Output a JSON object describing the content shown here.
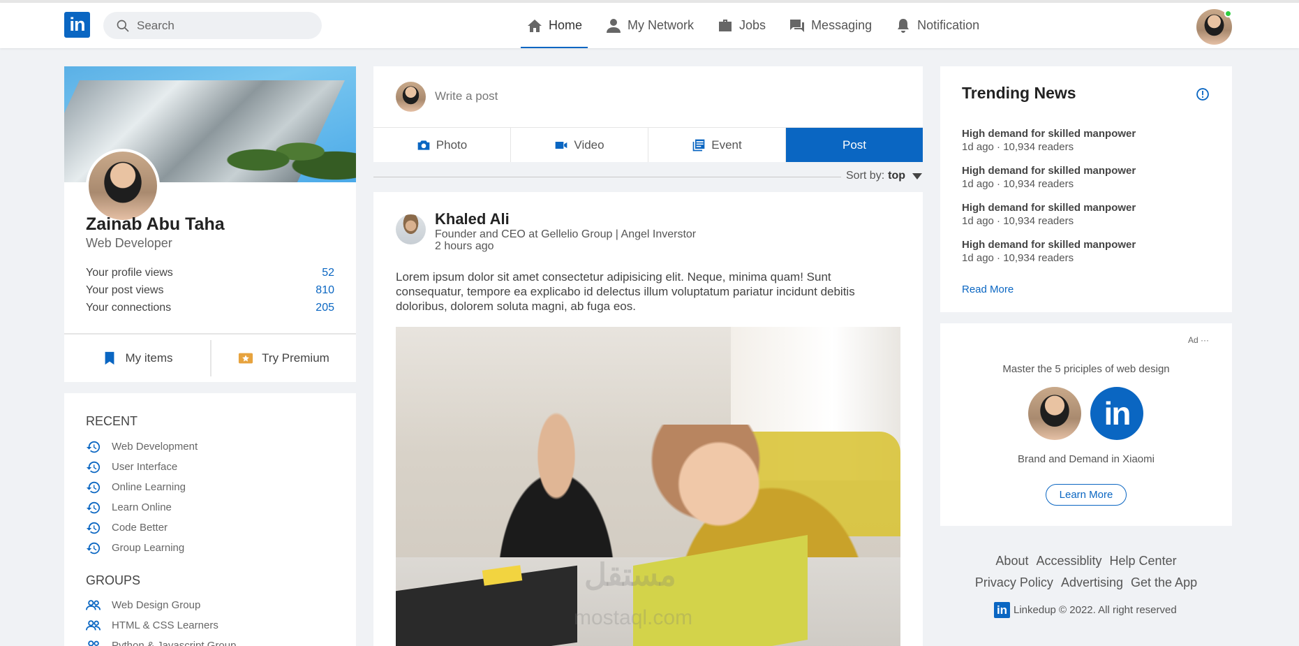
{
  "nav": {
    "logo_text": "in",
    "search_placeholder": "Search",
    "items": [
      {
        "label": "Home",
        "icon": "home-icon"
      },
      {
        "label": "My Network",
        "icon": "person-icon"
      },
      {
        "label": "Jobs",
        "icon": "briefcase-icon"
      },
      {
        "label": "Messaging",
        "icon": "chat-icon"
      },
      {
        "label": "Notification",
        "icon": "bell-icon"
      }
    ]
  },
  "profile": {
    "name": "Zainab Abu Taha",
    "title": "Web Developer",
    "stats": [
      {
        "label": "Your profile views",
        "value": "52"
      },
      {
        "label": "Your post views",
        "value": "810"
      },
      {
        "label": "Your connections",
        "value": "205"
      }
    ],
    "actions": {
      "my_items": "My items",
      "premium": "Try Premium"
    }
  },
  "sidebar": {
    "recent_heading": "RECENT",
    "recent": [
      "Web Development",
      "User Interface",
      "Online Learning",
      "Learn Online",
      "Code Better",
      "Group Learning"
    ],
    "groups_heading": "GROUPS",
    "groups": [
      "Web Design Group",
      "HTML & CSS Learners",
      "Python & Javascript Group"
    ]
  },
  "composer": {
    "placeholder": "Write a post",
    "tabs": {
      "photo": "Photo",
      "video": "Video",
      "event": "Event",
      "post": "Post"
    }
  },
  "sort": {
    "label": "Sort by:",
    "value": "top"
  },
  "post": {
    "author": "Khaled Ali",
    "headline": "Founder and CEO at Gellelio Group | Angel Inverstor",
    "time": "2 hours ago",
    "body": "Lorem ipsum dolor sit amet consectetur adipisicing elit. Neque, minima quam! Sunt consequatur, tempore ea explicabo id delectus illum voluptatum pariatur incidunt debitis doloribus, dolorem soluta magni, ab fuga eos.",
    "watermark": "مستقل",
    "watermark_sub": "mostaql.com"
  },
  "news": {
    "title": "Trending News",
    "items": [
      {
        "headline": "High demand for skilled manpower",
        "meta": "1d ago · 10,934 readers"
      },
      {
        "headline": "High demand for skilled manpower",
        "meta": "1d ago · 10,934 readers"
      },
      {
        "headline": "High demand for skilled manpower",
        "meta": "1d ago · 10,934 readers"
      },
      {
        "headline": "High demand for skilled manpower",
        "meta": "1d ago · 10,934 readers"
      }
    ],
    "read_more": "Read More"
  },
  "ad": {
    "label": "Ad ···",
    "text": "Master the 5 priciples of web design",
    "logo_text": "in",
    "sub": "Brand and Demand in Xiaomi",
    "button": "Learn More"
  },
  "footer": {
    "links": [
      "About",
      "Accessiblity",
      "Help Center",
      "Privacy Policy",
      "Advertising",
      "Get the App"
    ],
    "logo_text": "in",
    "copyright": "Linkedup © 2022. All right reserved"
  },
  "colors": {
    "brand": "#0a66c2",
    "background": "#f0f2f5",
    "online": "#2ecc40"
  }
}
